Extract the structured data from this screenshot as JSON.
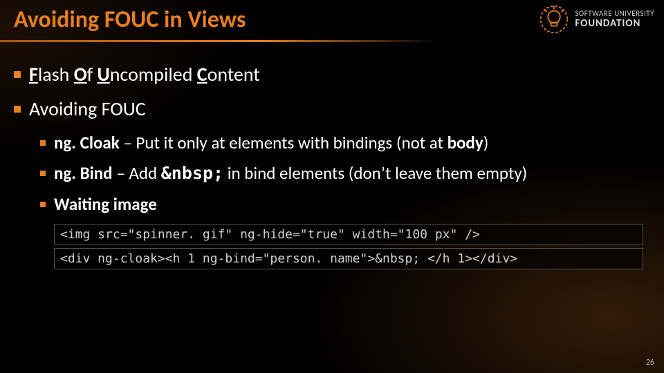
{
  "title": "Avoiding FOUC in Views",
  "logo": {
    "line1": "SOFTWARE UNIVERSITY",
    "line2": "FOUNDATION"
  },
  "bullets": {
    "b1_pre": "F",
    "b1_f": "lash ",
    "b1_o": "O",
    "b1_of": "f ",
    "b1_u": "U",
    "b1_un": "ncompiled ",
    "b1_c": "C",
    "b1_co": "ontent",
    "b2": "Avoiding FOUC",
    "s1_bold": "ng. Cloak",
    "s1_rest": " – Put it only at elements with bindings (not at ",
    "s1_body": "body",
    "s1_close": ")",
    "s2_bold": "ng. Bind",
    "s2_mid1": " – Add ",
    "s2_mono": "&nbsp;",
    "s2_mid2": " in bind elements (don’t leave them empty)",
    "s3_bold": "Waiting image"
  },
  "code": {
    "l1": "<img src=\"spinner. gif\" ng-hide=\"true\" width=\"100 px\" />",
    "l2": "<div ng-cloak><h 1 ng-bind=\"person. name\">&nbsp; </h 1></div>"
  },
  "page": "26"
}
